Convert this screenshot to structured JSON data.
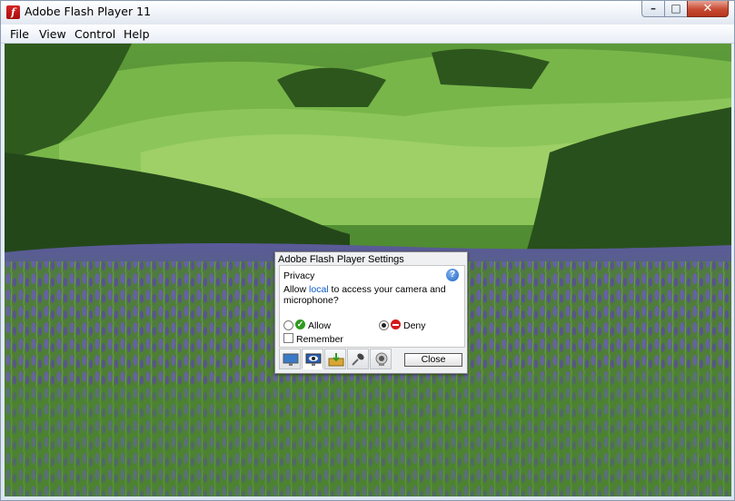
{
  "window": {
    "title": "Adobe Flash Player 11",
    "app_icon_glyph": "f",
    "controls": {
      "minimize_glyph": "–",
      "maximize_glyph": "□",
      "close_glyph": "✕"
    }
  },
  "menubar": {
    "items": [
      "File",
      "View",
      "Control",
      "Help"
    ]
  },
  "dialog": {
    "title": "Adobe Flash Player Settings",
    "section": "Privacy",
    "help_glyph": "?",
    "message_part1": "Allow ",
    "message_link": "local",
    "message_part2": " to access your camera and",
    "message_line2": "microphone?",
    "allow_label": "Allow",
    "deny_label": "Deny",
    "selected": "deny",
    "remember_label": "Remember",
    "remember_checked": false,
    "close_label": "Close",
    "tabs": [
      "display-icon",
      "privacy-icon",
      "local-storage-icon",
      "microphone-icon",
      "camera-icon"
    ],
    "active_tab": 1
  },
  "colors": {
    "link": "#0a5ac8",
    "allow_green": "#2f9a1e",
    "deny_red": "#d41a1a"
  }
}
